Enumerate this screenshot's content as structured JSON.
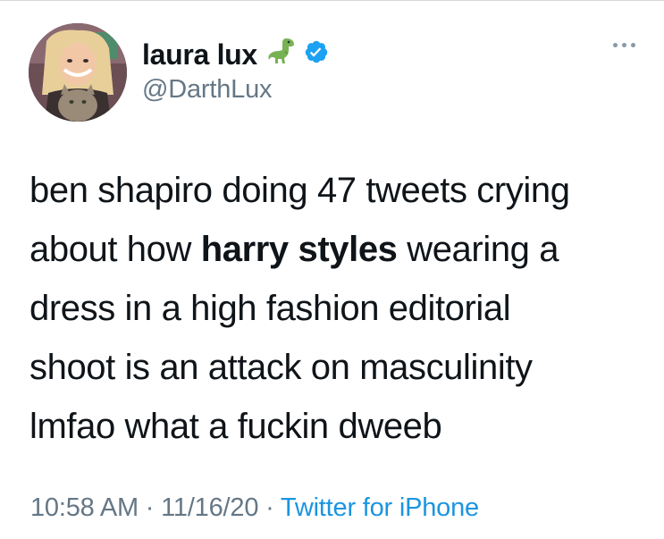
{
  "author": {
    "display_name": "laura lux",
    "emoji_icon": "t-rex-icon",
    "verified_icon": "verified-badge-icon",
    "handle": "@DarthLux"
  },
  "tweet": {
    "line1": "ben shapiro doing 47 tweets crying",
    "line2_before": "about how ",
    "line2_bold": "harry styles",
    "line2_after": " wearing a",
    "line3": "dress in a high fashion editorial",
    "line4": "shoot is an attack on masculinity",
    "line5": "lmfao what a fuckin dweeb"
  },
  "meta": {
    "time": "10:58 AM",
    "separator": " · ",
    "date": "11/16/20",
    "source": "Twitter for iPhone"
  },
  "colors": {
    "verified_blue": "#1da1f2",
    "link_blue": "#1b95e0",
    "secondary_gray": "#657786"
  }
}
